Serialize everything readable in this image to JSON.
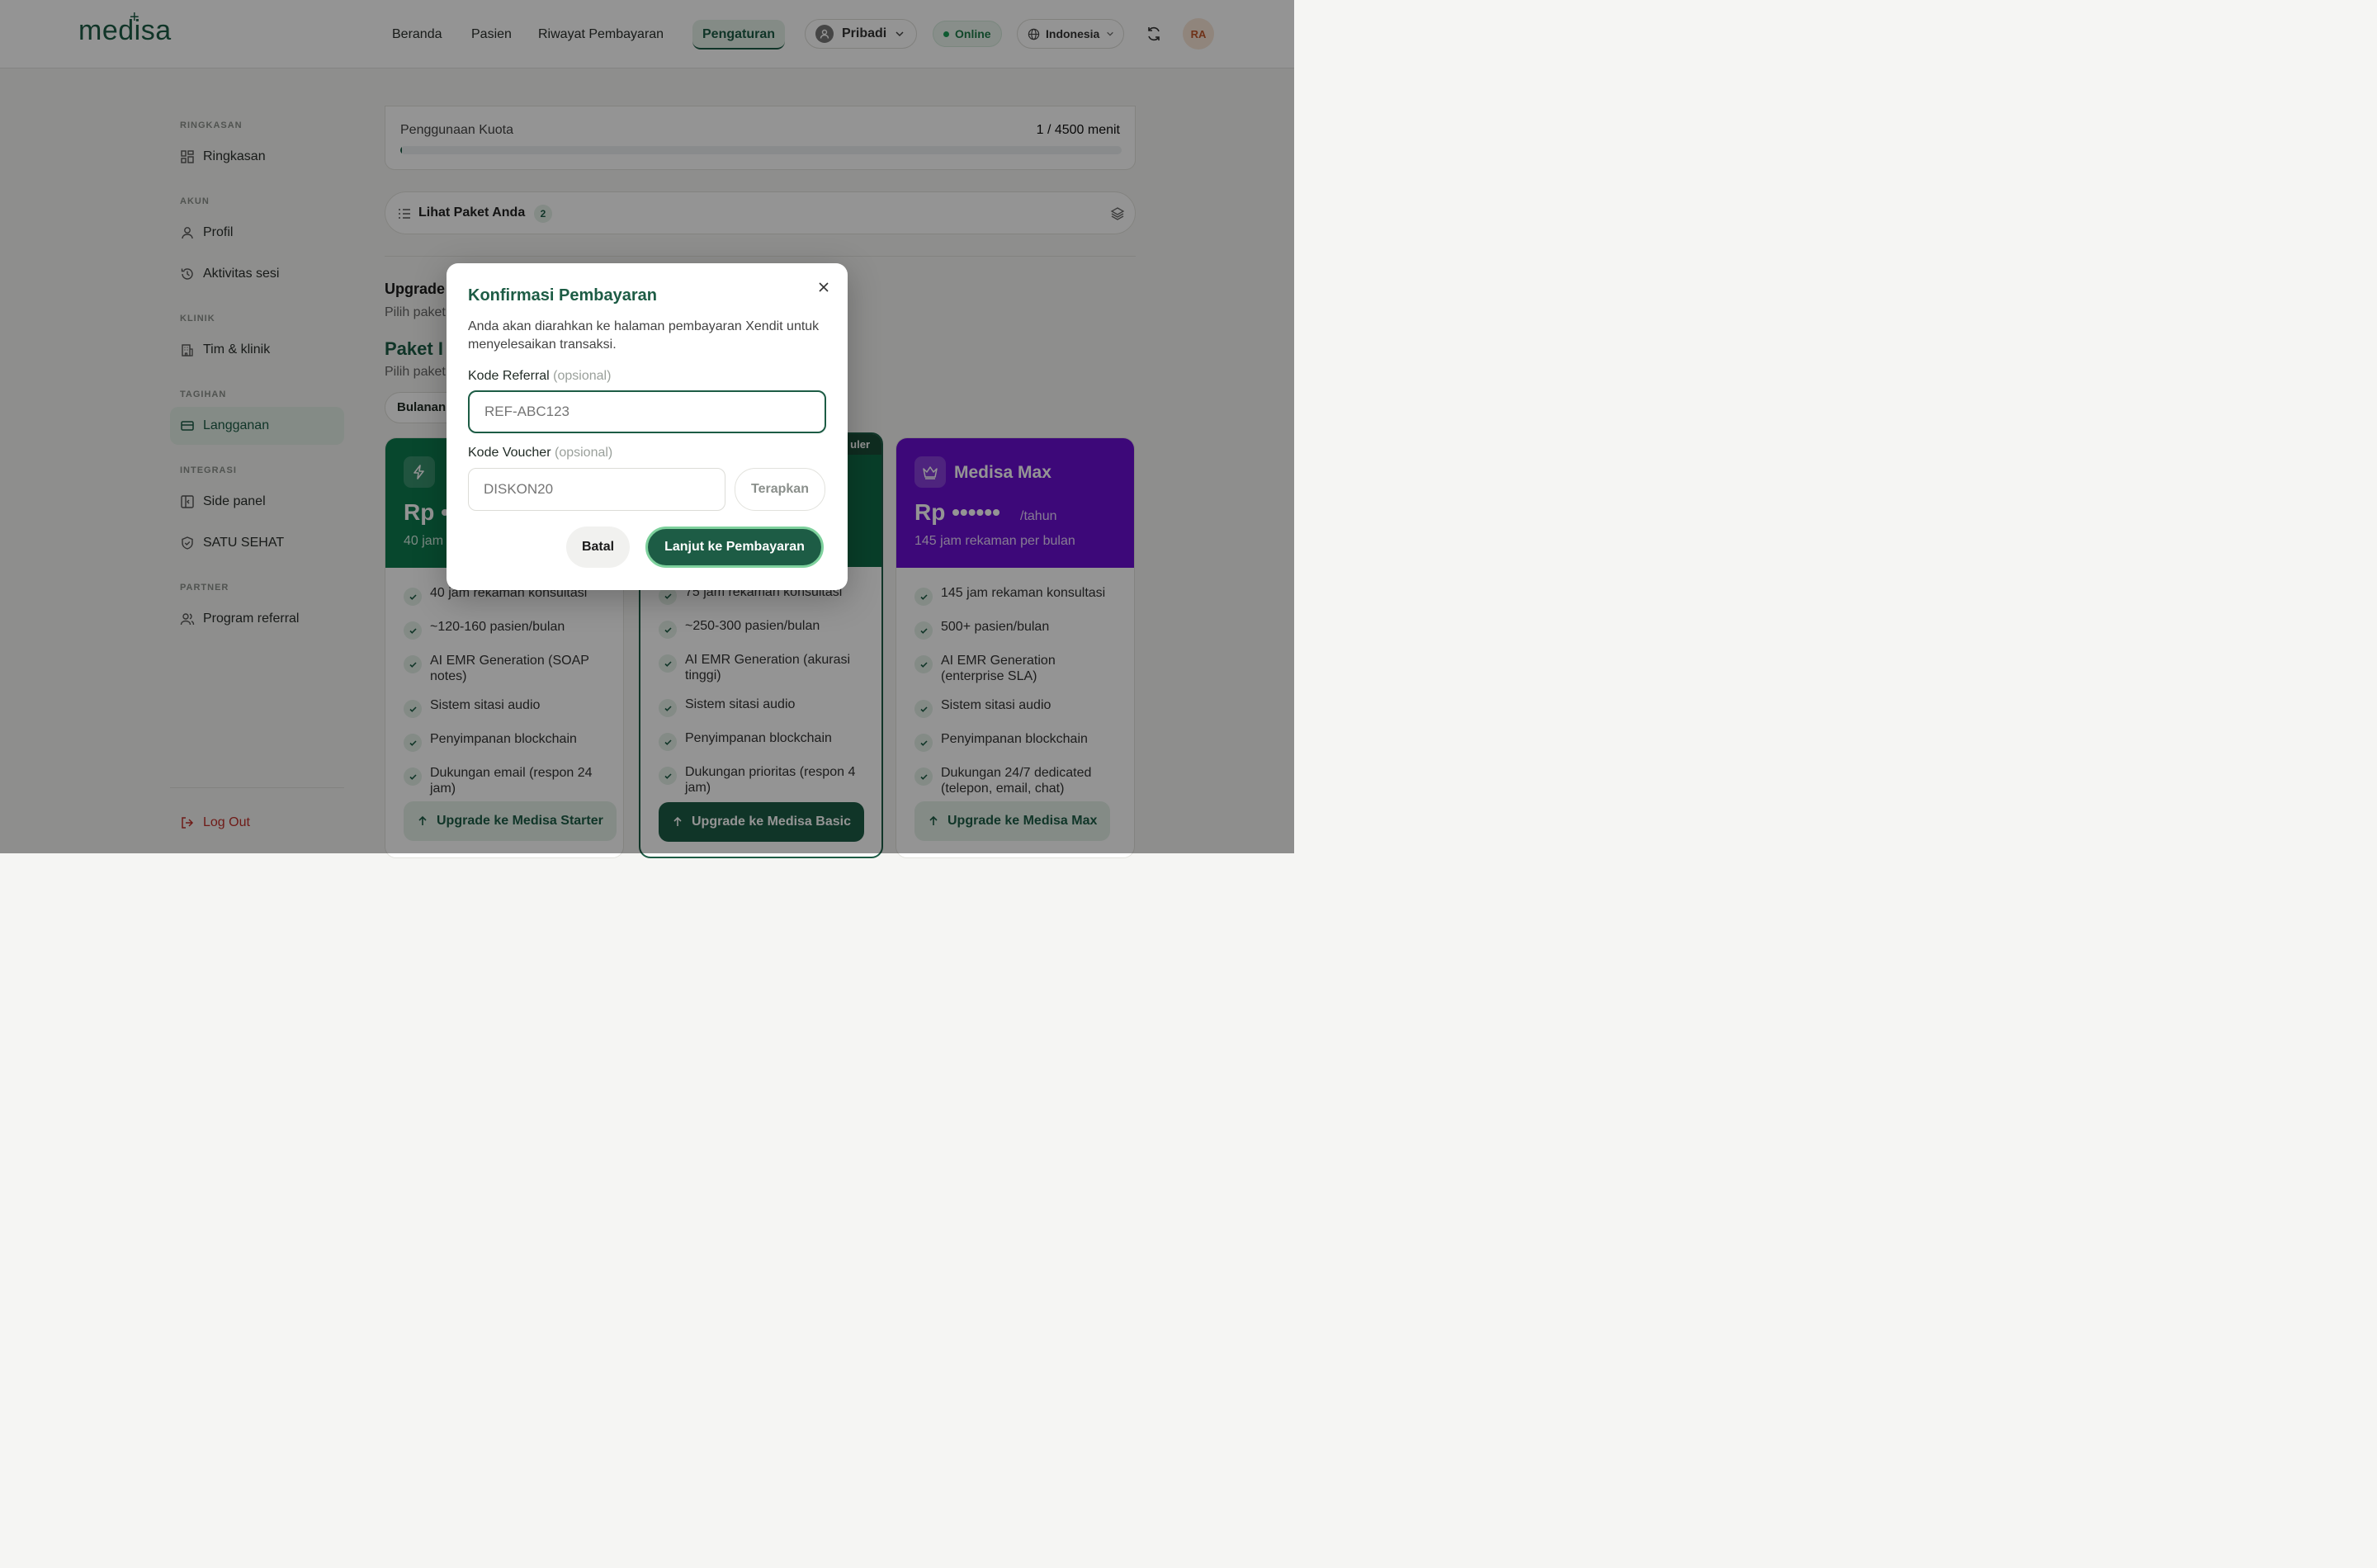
{
  "header": {
    "logo": "medisa",
    "nav": [
      "Beranda",
      "Pasien",
      "Riwayat Pembayaran",
      "Pengaturan"
    ],
    "active_nav": "Pengaturan",
    "workspace": "Pribadi",
    "status": "Online",
    "language": "Indonesia",
    "avatar_initials": "RA"
  },
  "sidebar": {
    "sections": [
      {
        "title": "RINGKASAN",
        "items": [
          "Ringkasan"
        ]
      },
      {
        "title": "AKUN",
        "items": [
          "Profil",
          "Aktivitas sesi"
        ]
      },
      {
        "title": "KLINIK",
        "items": [
          "Tim & klinik"
        ]
      },
      {
        "title": "TAGIHAN",
        "items": [
          "Langganan"
        ]
      },
      {
        "title": "INTEGRASI",
        "items": [
          "Side panel",
          "SATU SEHAT"
        ]
      },
      {
        "title": "PARTNER",
        "items": [
          "Program referral"
        ]
      }
    ],
    "active_item": "Langganan",
    "logout": "Log Out"
  },
  "main": {
    "quota_label": "Penggunaan Kuota",
    "quota_value": "1 / 4500 menit",
    "quota_fraction": 0.0002,
    "paket_label": "Lihat Paket Anda",
    "paket_count": "2",
    "upgrade_heading": "Upgrade",
    "upgrade_sub": "Pilih paket",
    "paket_heading": "Paket I",
    "paket_sub": "Pilih paket",
    "billing_toggle": "Bulanan",
    "popular_badge": "uler"
  },
  "cards": [
    {
      "title": "",
      "price": "Rp •",
      "period": "",
      "hours": "40 jam",
      "features": [
        "40 jam rekaman konsultasi",
        "~120-160 pasien/bulan",
        "AI EMR Generation (SOAP notes)",
        "Sistem sitasi audio",
        "Penyimpanan blockchain",
        "Dukungan email (respon 24 jam)"
      ],
      "button": "Upgrade ke Medisa Starter",
      "color": "#0d7a4e"
    },
    {
      "title": "",
      "price": "",
      "period": "",
      "hours": "",
      "features": [
        "75 jam rekaman konsultasi",
        "~250-300 pasien/bulan",
        "AI EMR Generation (akurasi tinggi)",
        "Sistem sitasi audio",
        "Penyimpanan blockchain",
        "Dukungan prioritas (respon 4 jam)"
      ],
      "button": "Upgrade ke Medisa Basic",
      "color": "#0f6b47"
    },
    {
      "title": "Medisa Max",
      "price": "Rp ••••••",
      "period": "/tahun",
      "hours": "145 jam rekaman per bulan",
      "features": [
        "145 jam rekaman konsultasi",
        "500+ pasien/bulan",
        "AI EMR Generation (enterprise SLA)",
        "Sistem sitasi audio",
        "Penyimpanan blockchain",
        "Dukungan 24/7 dedicated (telepon, email, chat)"
      ],
      "button": "Upgrade ke Medisa Max",
      "color": "#6a0fd1"
    }
  ],
  "modal": {
    "title": "Konfirmasi Pembayaran",
    "description": "Anda akan diarahkan ke halaman pembayaran Xendit untuk menyelesaikan transaksi.",
    "referral_label": "Kode Referral",
    "referral_optional": "(opsional)",
    "referral_placeholder": "REF-ABC123",
    "voucher_label": "Kode Voucher",
    "voucher_optional": "(opsional)",
    "voucher_placeholder": "DISKON20",
    "apply_button": "Terapkan",
    "cancel_button": "Batal",
    "proceed_button": "Lanjut ke Pembayaran"
  },
  "colors": {
    "brand": "#1d5c45",
    "max_purple": "#6a0fd1",
    "starter_green": "#0d7a4e"
  }
}
